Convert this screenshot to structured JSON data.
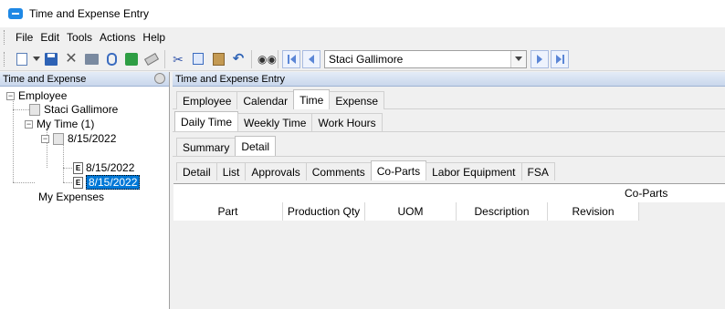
{
  "window": {
    "title": "Time and Expense Entry"
  },
  "menu": [
    "File",
    "Edit",
    "Tools",
    "Actions",
    "Help"
  ],
  "toolbar": {
    "employee_select": {
      "value": "Staci Gallimore"
    }
  },
  "left_panel": {
    "header": "Time and Expense",
    "tree": {
      "employee": "Employee",
      "employee_name": "Staci Gallimore",
      "my_time": "My Time (1)",
      "date_group": "8/15/2022",
      "entry_1": "8/15/2022",
      "entry_2": "8/15/2022",
      "my_expenses": "My Expenses"
    }
  },
  "right_panel": {
    "header": "Time and Expense Entry",
    "main_tabs": [
      "Employee",
      "Calendar",
      "Time",
      "Expense"
    ],
    "time_tabs": [
      "Daily Time",
      "Weekly Time",
      "Work Hours"
    ],
    "view_tabs": [
      "Summary",
      "Detail"
    ],
    "detail_tabs": [
      "Detail",
      "List",
      "Approvals",
      "Comments",
      "Co-Parts",
      "Labor Equipment",
      "FSA"
    ],
    "grid": {
      "band_title": "Co-Parts",
      "columns": [
        "Part",
        "Production Qty",
        "UOM",
        "Description",
        "Revision"
      ]
    }
  }
}
